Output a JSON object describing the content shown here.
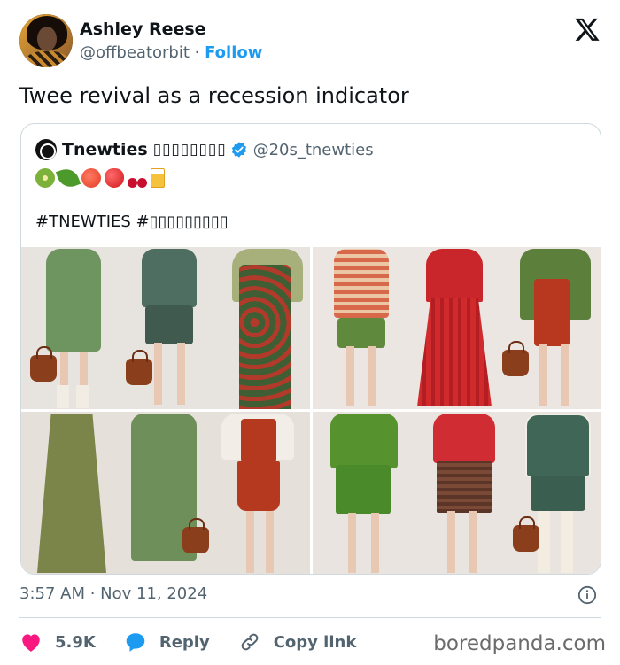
{
  "author": {
    "name": "Ashley Reese",
    "handle": "@offbeatorbit",
    "separator": "·",
    "follow_label": "Follow"
  },
  "tweet": {
    "text": "Twee revival as a recession indicator",
    "timestamp": "3:57 AM · Nov 11, 2024"
  },
  "quoted": {
    "name": "Tnewties",
    "name_suffix": "▯▯▯▯▯▯▯▯",
    "handle": "@20s_tnewties",
    "emojis": [
      "kiwi",
      "leafy-green",
      "tomato",
      "red-apple",
      "cherries",
      "juice-box"
    ],
    "hashtags": "#TNEWTIES #▯▯▯▯▯▯▯▯▯"
  },
  "actions": {
    "like_count": "5.9K",
    "reply_label": "Reply",
    "copy_link_label": "Copy link"
  },
  "watermark": "boredpanda.com",
  "colors": {
    "accent": "#1d9bf0",
    "like": "#f91880",
    "text": "#0f1419",
    "muted": "#536471",
    "border": "#cfd9de"
  }
}
